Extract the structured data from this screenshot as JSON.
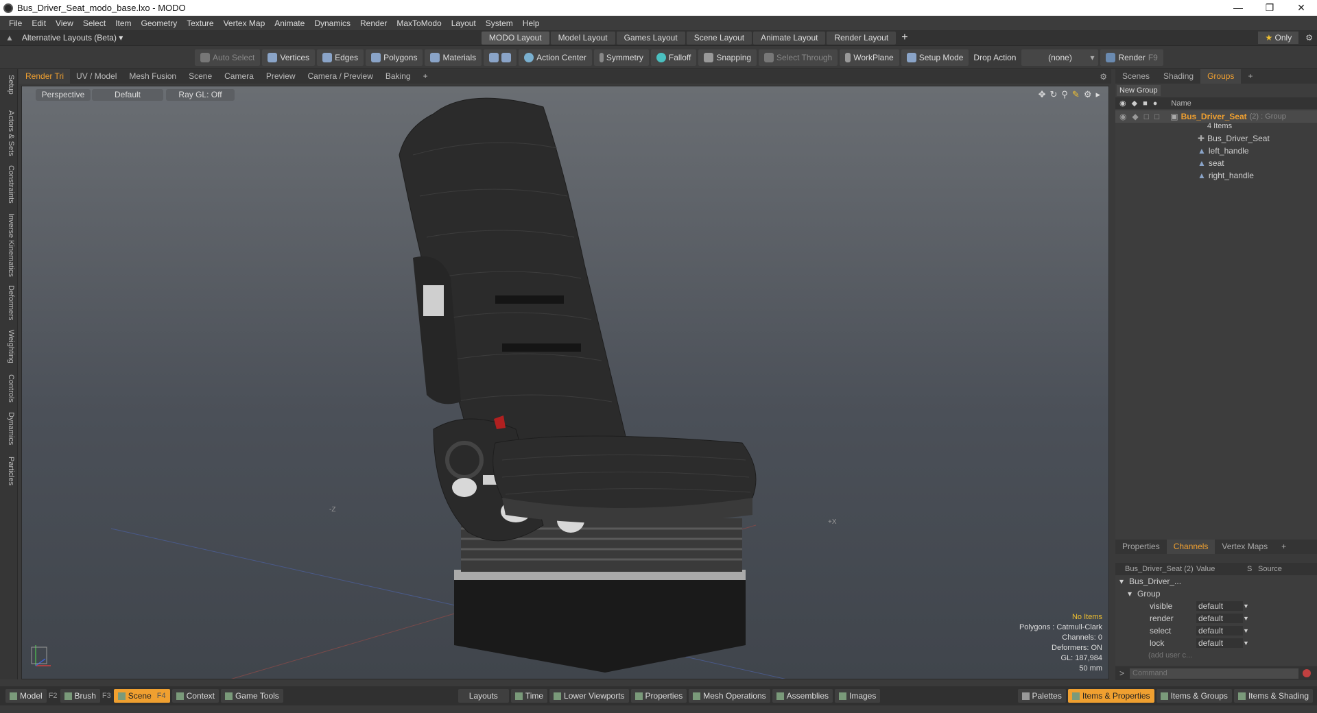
{
  "window": {
    "title": "Bus_Driver_Seat_modo_base.lxo - MODO"
  },
  "menu": [
    "File",
    "Edit",
    "View",
    "Select",
    "Item",
    "Geometry",
    "Texture",
    "Vertex Map",
    "Animate",
    "Dynamics",
    "Render",
    "MaxToModo",
    "Layout",
    "System",
    "Help"
  ],
  "layoutbar": {
    "alt_layouts": "Alternative Layouts (Beta)",
    "tabs": [
      "MODO Layout",
      "Model Layout",
      "Games Layout",
      "Scene Layout",
      "Animate Layout",
      "Render Layout"
    ],
    "plus": "+",
    "only": "Only"
  },
  "toolbar": {
    "auto_select": "Auto Select",
    "vertices": "Vertices",
    "edges": "Edges",
    "polygons": "Polygons",
    "materials": "Materials",
    "action_center": "Action Center",
    "symmetry": "Symmetry",
    "falloff": "Falloff",
    "snapping": "Snapping",
    "select_through": "Select Through",
    "workplane": "WorkPlane",
    "setup_mode": "Setup Mode",
    "drop_action": "Drop Action",
    "drop_value": "(none)",
    "render": "Render",
    "render_key": "F9"
  },
  "left_tabs": [
    "Setup",
    "Actors & Sets",
    "Constraints",
    "Inverse Kinematics",
    "Deformers",
    "Weighting",
    "Controls",
    "Dynamics",
    "Particles"
  ],
  "viewport_tabs": [
    "Render Tri",
    "UV / Model",
    "Mesh Fusion",
    "Scene",
    "Camera",
    "Preview",
    "Camera / Preview",
    "Baking",
    "+"
  ],
  "viewport": {
    "view": "Perspective",
    "shading": "Default",
    "raygl": "Ray GL: Off",
    "axis_minus_z": "-Z",
    "axis_plus_x": "+X",
    "info": {
      "items": "No Items",
      "polygons": "Polygons : Catmull-Clark",
      "channels": "Channels: 0",
      "deformers": "Deformers: ON",
      "gl": "GL: 187,984",
      "scale": "50 mm"
    }
  },
  "right_tabs_top": [
    "Scenes",
    "Shading",
    "Groups",
    "+"
  ],
  "groups": {
    "new_group": "New Group",
    "name_header": "Name",
    "group_name": "Bus_Driver_Seat",
    "group_suffix": "(2) : Group",
    "item_count": "4 Items",
    "children": [
      "Bus_Driver_Seat",
      "left_handle",
      "seat",
      "right_handle"
    ]
  },
  "right_tabs_bottom": [
    "Properties",
    "Channels",
    "Vertex Maps",
    "+"
  ],
  "channels": {
    "header_name": "Bus_Driver_Seat (2)",
    "header_value": "Value",
    "header_s": "S",
    "header_source": "Source",
    "root": "Bus_Driver_...",
    "group": "Group",
    "rows": [
      {
        "name": "visible",
        "value": "default"
      },
      {
        "name": "render",
        "value": "default"
      },
      {
        "name": "select",
        "value": "default"
      },
      {
        "name": "lock",
        "value": "default"
      }
    ],
    "add_user": "(add user c..."
  },
  "command": {
    "prompt": ">",
    "placeholder": "Command"
  },
  "bottombar": {
    "left": [
      {
        "label": "Model",
        "key": "F2"
      },
      {
        "label": "Brush",
        "key": "F3"
      },
      {
        "label": "Scene",
        "key": "F4"
      },
      {
        "label": "Context",
        "key": ""
      },
      {
        "label": "Game Tools",
        "key": ""
      }
    ],
    "middle": [
      "Layouts",
      "Time",
      "Lower Viewports",
      "Properties",
      "Mesh Operations",
      "Assemblies",
      "Images"
    ],
    "right": [
      "Palettes",
      "Items & Properties",
      "Items & Groups",
      "Items & Shading"
    ]
  },
  "colors": {
    "accent": "#f0a030",
    "active_text": "#f0a030"
  }
}
